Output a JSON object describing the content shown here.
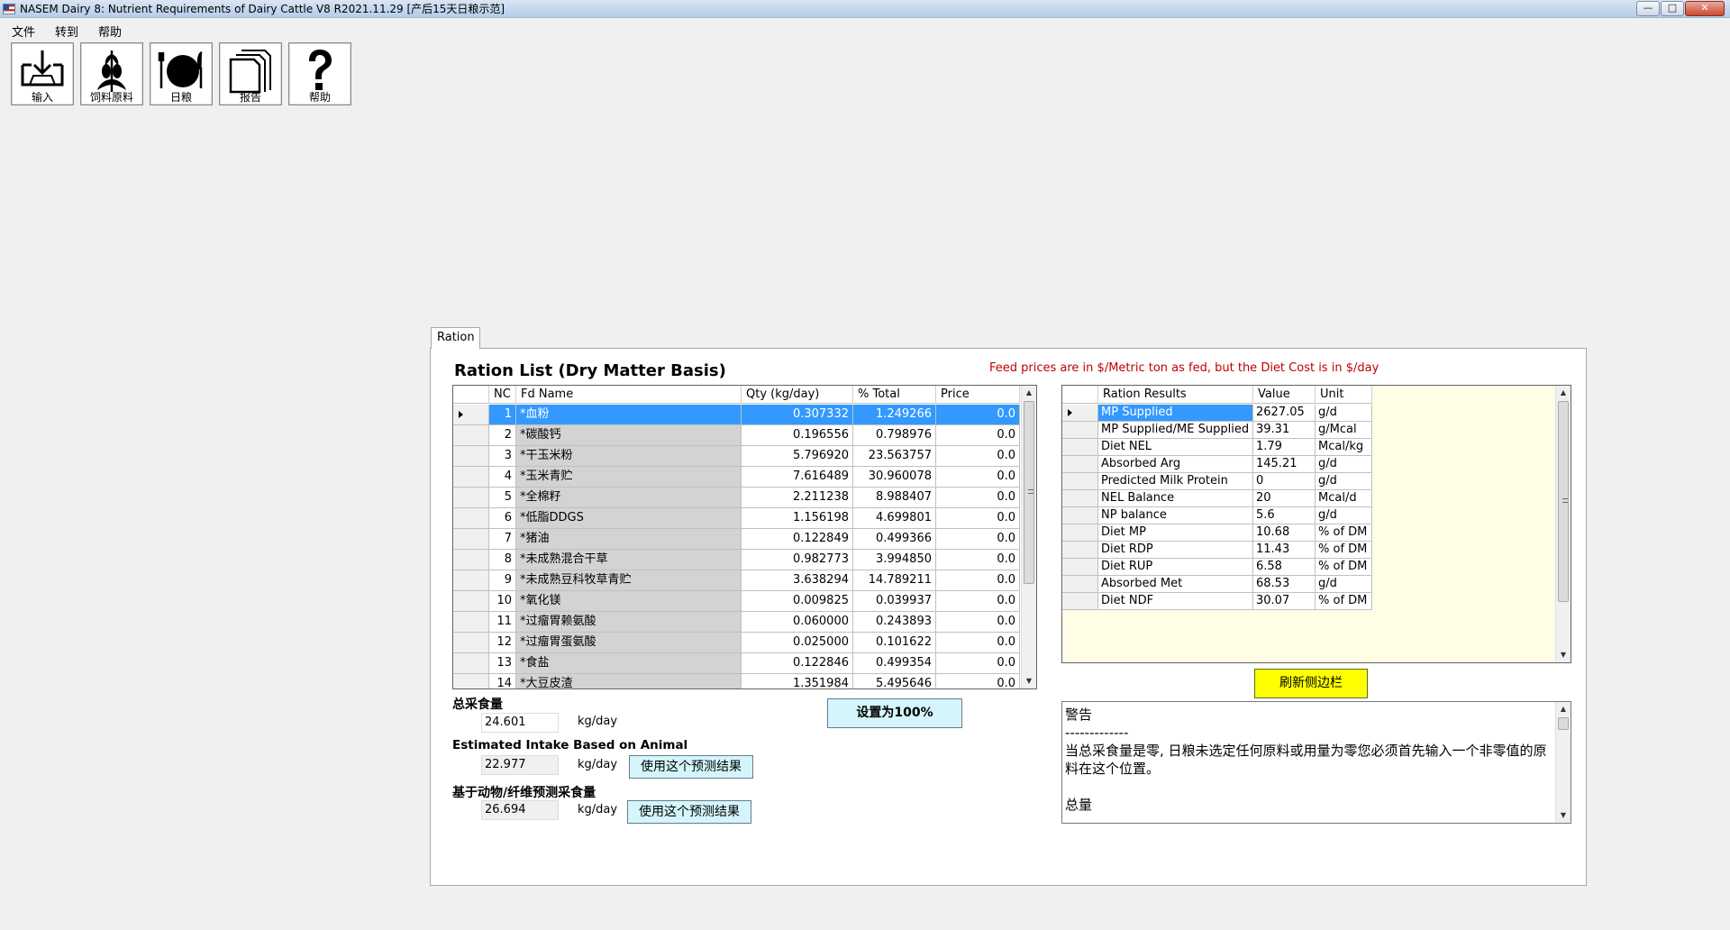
{
  "window": {
    "title": "NASEM Dairy 8: Nutrient Requirements of Dairy Cattle  V8 R2021.11.29 [产后15天日粮示范]",
    "minimize": "—",
    "maximize": "□",
    "close": "✕"
  },
  "menu": [
    "文件",
    "转到",
    "帮助"
  ],
  "toolbar": [
    {
      "label": "输入",
      "icon": "input-tray-icon"
    },
    {
      "label": "饲料原料",
      "icon": "corn-plant-icon"
    },
    {
      "label": "日粮",
      "icon": "plate-fork-knife-icon"
    },
    {
      "label": "报告",
      "icon": "report-pages-icon"
    },
    {
      "label": "帮助",
      "icon": "question-mark-icon"
    }
  ],
  "tab": {
    "label": "Ration"
  },
  "ration": {
    "title": "Ration List (Dry Matter Basis)",
    "price_note": "Feed prices are in $/Metric ton as fed, but the Diet Cost is in $/day",
    "columns": [
      "NC",
      "Fd  Name",
      "Qty (kg/day)",
      "% Total",
      "Price"
    ],
    "rows": [
      {
        "nc": "1",
        "name": "*血粉",
        "qty": "0.307332",
        "pct": "1.249266",
        "price": "0.0"
      },
      {
        "nc": "2",
        "name": "*碳酸钙",
        "qty": "0.196556",
        "pct": "0.798976",
        "price": "0.0"
      },
      {
        "nc": "3",
        "name": "*干玉米粉",
        "qty": "5.796920",
        "pct": "23.563757",
        "price": "0.0"
      },
      {
        "nc": "4",
        "name": "*玉米青贮",
        "qty": "7.616489",
        "pct": "30.960078",
        "price": "0.0"
      },
      {
        "nc": "5",
        "name": "*全棉籽",
        "qty": "2.211238",
        "pct": "8.988407",
        "price": "0.0"
      },
      {
        "nc": "6",
        "name": "*低脂DDGS",
        "qty": "1.156198",
        "pct": "4.699801",
        "price": "0.0"
      },
      {
        "nc": "7",
        "name": "*猪油",
        "qty": "0.122849",
        "pct": "0.499366",
        "price": "0.0"
      },
      {
        "nc": "8",
        "name": "*未成熟混合干草",
        "qty": "0.982773",
        "pct": "3.994850",
        "price": "0.0"
      },
      {
        "nc": "9",
        "name": "*未成熟豆科牧草青贮",
        "qty": "3.638294",
        "pct": "14.789211",
        "price": "0.0"
      },
      {
        "nc": "10",
        "name": "*氧化镁",
        "qty": "0.009825",
        "pct": "0.039937",
        "price": "0.0"
      },
      {
        "nc": "11",
        "name": "*过瘤胃赖氨酸",
        "qty": "0.060000",
        "pct": "0.243893",
        "price": "0.0"
      },
      {
        "nc": "12",
        "name": "*过瘤胃蛋氨酸",
        "qty": "0.025000",
        "pct": "0.101622",
        "price": "0.0"
      },
      {
        "nc": "13",
        "name": "*食盐",
        "qty": "0.122846",
        "pct": "0.499354",
        "price": "0.0"
      },
      {
        "nc": "14",
        "name": "*大豆皮渣",
        "qty": "1.351984",
        "pct": "5.495646",
        "price": "0.0"
      }
    ]
  },
  "intake": {
    "total_label": "总采食量",
    "total_value": "24.601",
    "est_label": "Estimated Intake Based on Animal",
    "est_value": "22.977",
    "fiber_label": "基于动物/纤维预测采食量",
    "fiber_value": "26.694",
    "unit": "kg/day",
    "use_pred_btn": "使用这个预测结果",
    "set100_btn": "设置为100%"
  },
  "results": {
    "columns": [
      "Ration Results",
      "Value",
      "Unit"
    ],
    "rows": [
      {
        "name": "MP Supplied",
        "value": "2627.05",
        "unit": "g/d"
      },
      {
        "name": "MP Supplied/ME Supplied",
        "value": "39.31",
        "unit": "g/Mcal"
      },
      {
        "name": "Diet NEL",
        "value": "1.79",
        "unit": "Mcal/kg"
      },
      {
        "name": "Absorbed Arg",
        "value": "145.21",
        "unit": "g/d"
      },
      {
        "name": "Predicted Milk Protein",
        "value": "0",
        "unit": "g/d"
      },
      {
        "name": "NEL Balance",
        "value": "20",
        "unit": "Mcal/d"
      },
      {
        "name": "NP balance",
        "value": "5.6",
        "unit": "g/d"
      },
      {
        "name": "Diet MP",
        "value": "10.68",
        "unit": "% of DM"
      },
      {
        "name": "Diet RDP",
        "value": "11.43",
        "unit": "% of DM"
      },
      {
        "name": "Diet RUP",
        "value": "6.58",
        "unit": "% of DM"
      },
      {
        "name": "Absorbed Met",
        "value": "68.53",
        "unit": "g/d"
      },
      {
        "name": "Diet NDF",
        "value": "30.07",
        "unit": "% of DM"
      }
    ],
    "refresh_btn": "刷新侧边栏"
  },
  "warnings": {
    "line1": "警告",
    "line2": "-------------",
    "line3": "当总采食量是零, 日粮未选定任何原料或用量为零您必须首先输入一个非零值的原料在这个位置。",
    "line4": "",
    "line5": "总量",
    "line6": "--------"
  },
  "scroll": {
    "up": "▲",
    "down": "▼"
  }
}
